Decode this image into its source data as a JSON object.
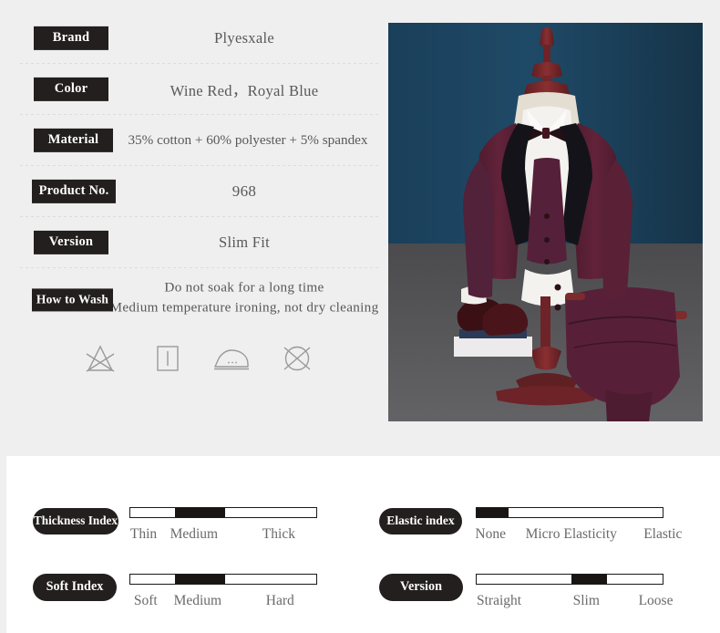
{
  "spec": {
    "rows": [
      {
        "label": "Brand",
        "value": "Plyesxale",
        "name": "brand"
      },
      {
        "label": "Color",
        "value": "Wine Red，Royal Blue",
        "name": "color"
      },
      {
        "label": "Material",
        "value": "35% cotton + 60% polyester + 5% spandex",
        "name": "material"
      },
      {
        "label": "Product No.",
        "value": "968",
        "name": "product-no"
      },
      {
        "label": "Version",
        "value": "Slim  Fit",
        "name": "version"
      }
    ],
    "wash": {
      "label": "How to Wash",
      "line1": "Do not soak for a long time",
      "line2": "Medium temperature ironing, not dry cleaning"
    },
    "care_icons": [
      {
        "name": "no-bleach-icon",
        "title": "Do not bleach"
      },
      {
        "name": "drip-dry-icon",
        "title": "Drip dry"
      },
      {
        "name": "iron-medium-icon",
        "title": "Medium temperature ironing"
      },
      {
        "name": "no-dry-clean-icon",
        "title": "Do not dry clean"
      }
    ]
  },
  "product_photo": {
    "alt": "Wine red three-piece slim fit suit on a mannequin",
    "background_color": "#1d4560",
    "suit_color": "#5a2035",
    "floor_color": "#555558"
  },
  "indexes": [
    {
      "name": "thickness-index",
      "label": "Thickness Index",
      "scale": [
        "Thin",
        "Medium",
        "Thick"
      ],
      "selected": "Medium",
      "fill_start_pct": 24,
      "fill_end_pct": 51,
      "label_offsets_pct": [
        3,
        22,
        66
      ]
    },
    {
      "name": "soft-index",
      "label": "Soft  Index",
      "scale": [
        "Soft",
        "Medium",
        "Hard"
      ],
      "selected": "Medium",
      "fill_start_pct": 24,
      "fill_end_pct": 51,
      "label_offsets_pct": [
        3,
        22,
        66
      ]
    },
    {
      "name": "elastic-index",
      "label": "Elastic index",
      "scale": [
        "None",
        "Micro Elasticity",
        "Elastic"
      ],
      "selected": "None",
      "fill_start_pct": 0,
      "fill_end_pct": 17,
      "label_offsets_pct": [
        1,
        24,
        78
      ]
    },
    {
      "name": "version-index",
      "label": "Version",
      "scale": [
        "Straight",
        "Slim",
        "Loose"
      ],
      "selected": "Slim",
      "fill_start_pct": 51,
      "fill_end_pct": 70,
      "label_offsets_pct": [
        0,
        44,
        74
      ]
    }
  ],
  "colors": {
    "section_bg": "#efefef",
    "badge_bg": "#231f1e",
    "badge_text": "#ffffff",
    "value_text": "#58585a",
    "scale_text": "#6a6a6c",
    "separator": "#dcdcdc",
    "bar_border": "#1a1a1a",
    "bar_fill": "#191513",
    "icon_stroke": "#9a9a9a"
  }
}
